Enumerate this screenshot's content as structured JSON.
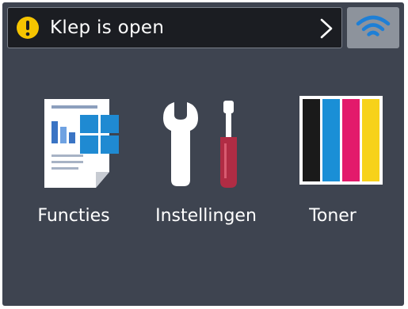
{
  "status": {
    "message": "Klep is open",
    "warning_icon": "warning-circle-icon",
    "chevron_icon": "chevron-right-icon",
    "warning_color": "#f5c400"
  },
  "wifi": {
    "icon": "wifi-icon",
    "color": "#1e7fd6"
  },
  "menu": {
    "items": [
      {
        "label": "Functies",
        "icon": "functions-document-icon"
      },
      {
        "label": "Instellingen",
        "icon": "tools-wrench-screwdriver-icon"
      },
      {
        "label": "Toner",
        "icon": "toner-cartridges-icon"
      }
    ]
  },
  "toner": {
    "colors": [
      "#1a1a1a",
      "#1a8fd6",
      "#e31a6b",
      "#f7d21a"
    ]
  },
  "theme": {
    "background": "#3e4450",
    "status_bar": "#1b1d22",
    "wifi_button": "#8d939c"
  }
}
